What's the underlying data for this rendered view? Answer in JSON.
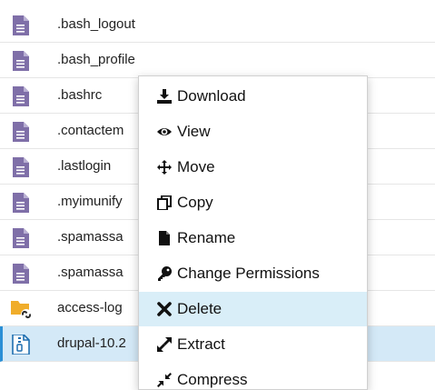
{
  "files": [
    {
      "name": ".bash_logout",
      "type": "document",
      "selected": false
    },
    {
      "name": ".bash_profile",
      "type": "document",
      "selected": false
    },
    {
      "name": ".bashrc",
      "type": "document",
      "selected": false
    },
    {
      "name": ".contactem",
      "type": "document",
      "selected": false
    },
    {
      "name": ".lastlogin",
      "type": "document",
      "selected": false
    },
    {
      "name": ".myimunify",
      "type": "document",
      "selected": false
    },
    {
      "name": ".spamassa",
      "type": "document",
      "selected": false
    },
    {
      "name": ".spamassa",
      "type": "document",
      "selected": false
    },
    {
      "name": "access-log",
      "type": "folder-link",
      "selected": false
    },
    {
      "name": "drupal-10.2",
      "type": "archive",
      "selected": true
    }
  ],
  "context_menu": {
    "items": [
      {
        "label": "Download",
        "icon": "download-icon"
      },
      {
        "label": "View",
        "icon": "eye-icon"
      },
      {
        "label": "Move",
        "icon": "move-icon"
      },
      {
        "label": "Copy",
        "icon": "copy-icon"
      },
      {
        "label": "Rename",
        "icon": "file-icon"
      },
      {
        "label": "Change Permissions",
        "icon": "key-icon"
      },
      {
        "label": "Delete",
        "icon": "close-icon"
      },
      {
        "label": "Extract",
        "icon": "expand-icon"
      },
      {
        "label": "Compress",
        "icon": "compress-icon"
      }
    ],
    "active_item": "Delete"
  },
  "colors": {
    "doc_icon": "#7f6fa8",
    "folder_icon": "#f0ad2a",
    "link_badge": "#2b2b2b",
    "archive_icon": "#1f6fb0",
    "selected_row": "#d4e9f7",
    "selected_border": "#2a8fd6",
    "menu_highlight": "#d9eef8"
  }
}
